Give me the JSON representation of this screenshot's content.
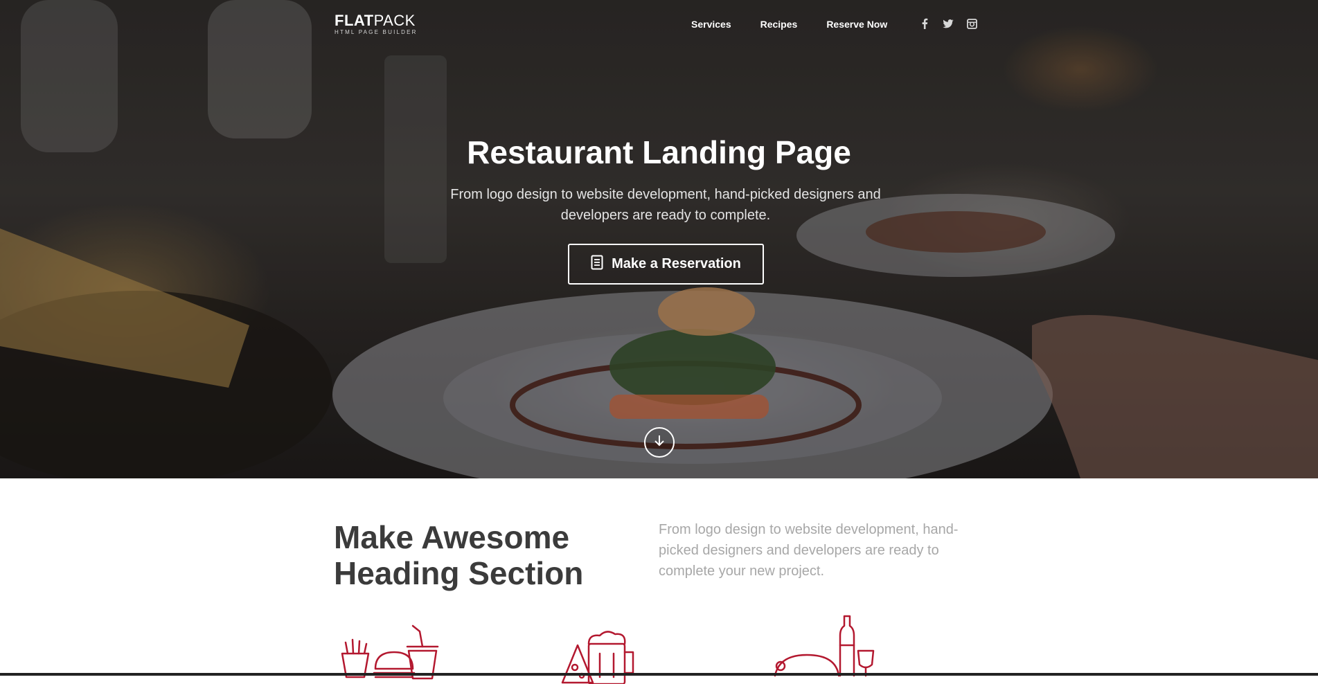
{
  "brand": {
    "name_bold": "FLAT",
    "name_light": "PACK",
    "tagline": "HTML PAGE BUILDER"
  },
  "nav": {
    "items": [
      {
        "label": "Services"
      },
      {
        "label": "Recipes"
      },
      {
        "label": "Reserve Now"
      }
    ],
    "social": [
      "facebook-icon",
      "twitter-icon",
      "instagram-icon"
    ]
  },
  "hero": {
    "title": "Restaurant Landing Page",
    "subtitle": "From logo design to website development, hand-picked designers and developers are ready to complete.",
    "cta_label": "Make a Reservation",
    "cta_icon": "document-icon",
    "scroll_icon": "arrow-down-circle-icon"
  },
  "intro": {
    "heading": "Make Awesome Heading Section",
    "text": "From logo design to website development, hand-picked designers and developers are ready to complete your new project."
  },
  "features": {
    "icons": [
      "fastfood-icon",
      "cheese-beer-icon",
      "dinner-wine-icon"
    ]
  },
  "colors": {
    "accent": "#b3182f",
    "heading": "#3b3b3b",
    "muted": "#a7a7a7",
    "white": "#ffffff"
  }
}
